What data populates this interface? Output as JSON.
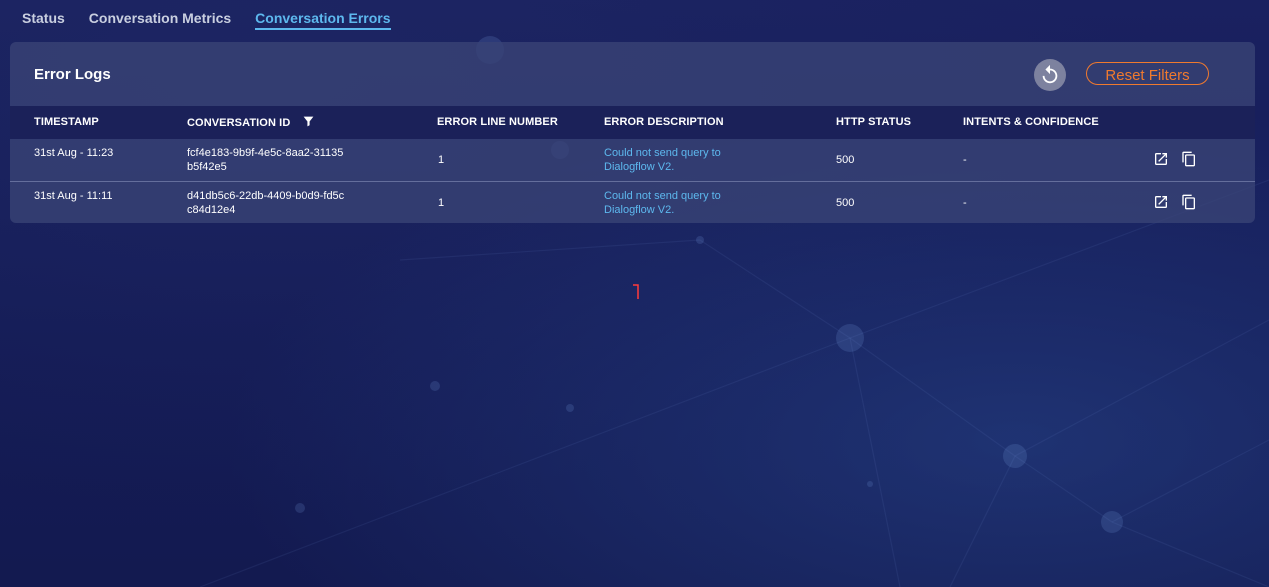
{
  "tabs": [
    {
      "label": "Status",
      "active": false
    },
    {
      "label": "Conversation Metrics",
      "active": false
    },
    {
      "label": "Conversation Errors",
      "active": true
    }
  ],
  "panel": {
    "title": "Error Logs",
    "reset_label": "Reset Filters",
    "refresh_icon": "refresh-icon"
  },
  "table": {
    "headers": {
      "timestamp": "TIMESTAMP",
      "conversation_id": "CONVERSATION ID",
      "error_line": "ERROR LINE NUMBER",
      "error_description": "ERROR DESCRIPTION",
      "http_status": "HTTP STATUS",
      "intents": "INTENTS & CONFIDENCE"
    },
    "rows": [
      {
        "timestamp": "31st Aug - 11:23",
        "conversation_id": "fcf4e183-9b9f-4e5c-8aa2-31135b5f42e5",
        "error_line": "1",
        "error_description": "Could not send query to Dialogflow V2.",
        "http_status": "500",
        "intents": "-"
      },
      {
        "timestamp": "31st Aug - 11:11",
        "conversation_id": "d41db5c6-22db-4409-b0d9-fd5cc84d12e4",
        "error_line": "1",
        "error_description": "Could not send query to Dialogflow V2.",
        "http_status": "500",
        "intents": "-"
      }
    ]
  },
  "colors": {
    "accent": "#5db8ee",
    "reset": "#f07a2e",
    "background": "#141b52"
  }
}
